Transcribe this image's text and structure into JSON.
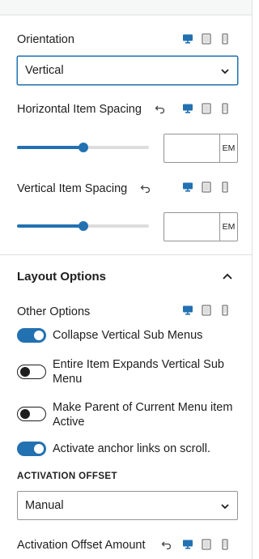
{
  "orientation": {
    "label": "Orientation",
    "selected": "Vertical"
  },
  "horizontal_spacing": {
    "label": "Horizontal Item Spacing",
    "slider_fraction": 0.5,
    "value": "",
    "unit": "EM"
  },
  "vertical_spacing": {
    "label": "Vertical Item Spacing",
    "slider_fraction": 0.5,
    "value": "",
    "unit": "EM"
  },
  "layout_options": {
    "title": "Layout Options",
    "other_options_label": "Other Options",
    "toggles": [
      {
        "label": "Collapse Vertical Sub Menus",
        "on": true
      },
      {
        "label": "Entire Item Expands Vertical Sub Menu",
        "on": false
      },
      {
        "label": "Make Parent of Current Menu item Active",
        "on": false
      },
      {
        "label": "Activate anchor links on scroll.",
        "on": true
      }
    ],
    "activation_offset_label": "ACTIVATION OFFSET",
    "activation_offset_selected": "Manual",
    "activation_offset_amount_label": "Activation Offset Amount"
  },
  "icons": {
    "reset": "reset-arrow-icon",
    "desktop": "desktop-icon",
    "tablet": "tablet-icon",
    "mobile": "mobile-icon",
    "dropdown": "chevron-down-icon",
    "collapse": "chevron-up-icon"
  },
  "colors": {
    "accent": "#2271b1",
    "text": "#1e1e1e",
    "border": "#949494",
    "divider": "#e0e0e0"
  }
}
